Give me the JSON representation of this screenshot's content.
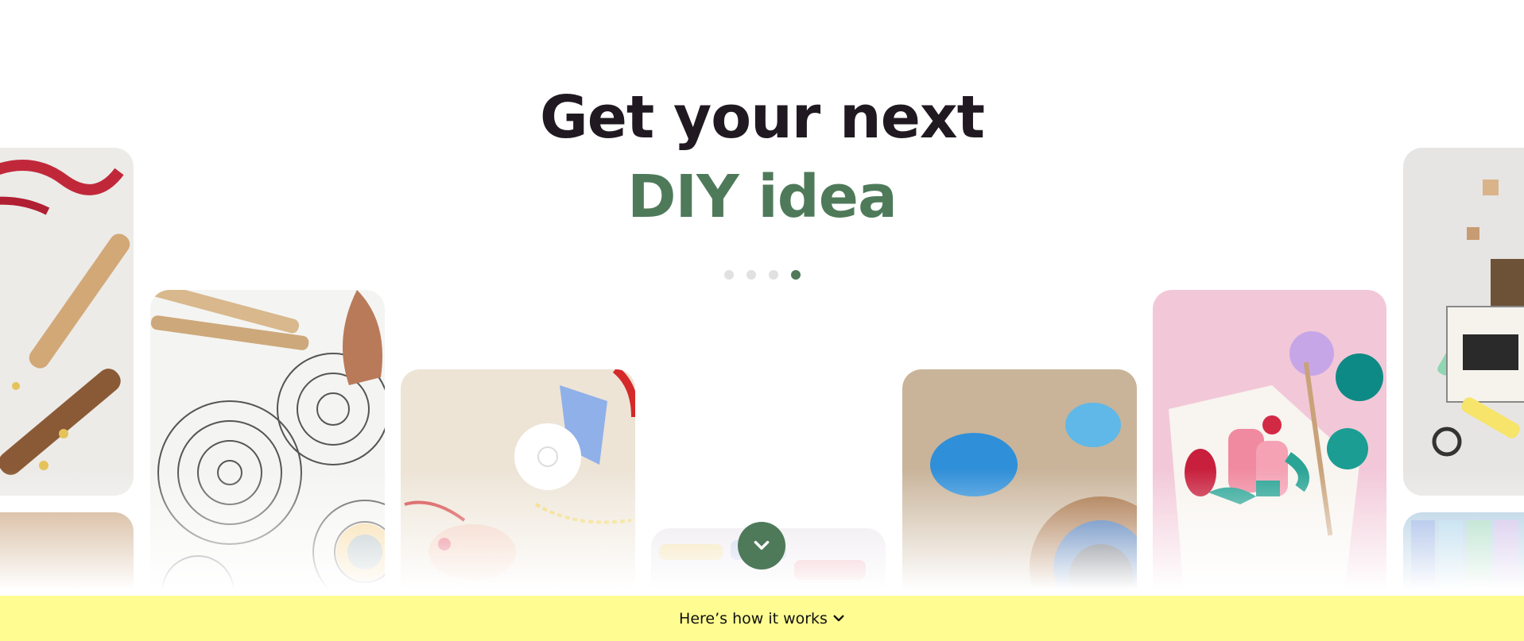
{
  "hero": {
    "line1": "Get your next",
    "line2": "DIY idea"
  },
  "carousel": {
    "dot_count": 4,
    "active_index": 3
  },
  "footer_bar": {
    "label": "Here’s how it works"
  },
  "colors": {
    "headline_dark": "#211922",
    "accent_green": "#4e7a5a",
    "bar_yellow": "#fffd92",
    "dot_inactive": "#e1e1e1"
  },
  "icons": {
    "scroll_button": "chevron-down-icon",
    "bar_icon": "chevron-down-icon"
  }
}
